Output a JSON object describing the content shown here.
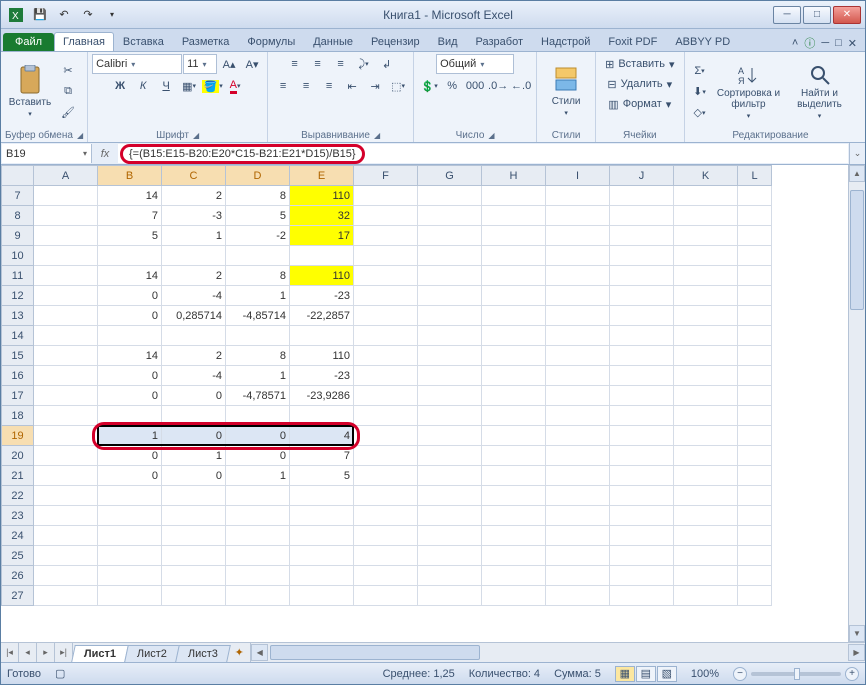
{
  "title": "Книга1 - Microsoft Excel",
  "qat": {
    "save": "💾",
    "undo": "↶",
    "redo": "↷"
  },
  "win": {
    "min": "─",
    "max": "□",
    "close": "✕",
    "help": "?"
  },
  "tabs": {
    "file": "Файл",
    "items": [
      "Главная",
      "Вставка",
      "Разметка",
      "Формулы",
      "Данные",
      "Рецензир",
      "Вид",
      "Разработ",
      "Надстрой",
      "Foxit PDF",
      "ABBYY PD"
    ],
    "activeIndex": 0,
    "helpIcon": "ⓘ"
  },
  "ribbon": {
    "clipboard": {
      "label": "Буфер обмена",
      "paste": "Вставить"
    },
    "font": {
      "label": "Шрифт",
      "family": "Calibri",
      "size": "11",
      "bold": "Ж",
      "italic": "К",
      "underline": "Ч"
    },
    "align": {
      "label": "Выравнивание"
    },
    "number": {
      "label": "Число",
      "format": "Общий"
    },
    "styles": {
      "label": "Стили",
      "btn": "Стили"
    },
    "cells": {
      "label": "Ячейки",
      "insert": "Вставить",
      "delete": "Удалить",
      "format": "Формат"
    },
    "editing": {
      "label": "Редактирование",
      "sort": "Сортировка и фильтр",
      "find": "Найти и выделить"
    }
  },
  "namebox": "B19",
  "fx_label": "fx",
  "formula": "{=(B15:E15-B20:E20*C15-B21:E21*D15)/B15}",
  "columns": [
    "A",
    "B",
    "C",
    "D",
    "E",
    "F",
    "G",
    "H",
    "I",
    "J",
    "K",
    "L"
  ],
  "selectedCols": [
    "B",
    "C",
    "D",
    "E"
  ],
  "rows": [
    {
      "n": 7,
      "c": {
        "B": "14",
        "C": "2",
        "D": "8",
        "E": "110"
      },
      "yellow": [
        "E"
      ]
    },
    {
      "n": 8,
      "c": {
        "B": "7",
        "C": "-3",
        "D": "5",
        "E": "32"
      },
      "yellow": [
        "E"
      ]
    },
    {
      "n": 9,
      "c": {
        "B": "5",
        "C": "1",
        "D": "-2",
        "E": "17"
      },
      "yellow": [
        "E"
      ]
    },
    {
      "n": 10,
      "c": {}
    },
    {
      "n": 11,
      "c": {
        "B": "14",
        "C": "2",
        "D": "8",
        "E": "110"
      },
      "yellow": [
        "E"
      ]
    },
    {
      "n": 12,
      "c": {
        "B": "0",
        "C": "-4",
        "D": "1",
        "E": "-23"
      }
    },
    {
      "n": 13,
      "c": {
        "B": "0",
        "C": "0,285714",
        "D": "-4,85714",
        "E": "-22,2857"
      }
    },
    {
      "n": 14,
      "c": {}
    },
    {
      "n": 15,
      "c": {
        "B": "14",
        "C": "2",
        "D": "8",
        "E": "110"
      }
    },
    {
      "n": 16,
      "c": {
        "B": "0",
        "C": "-4",
        "D": "1",
        "E": "-23"
      }
    },
    {
      "n": 17,
      "c": {
        "B": "0",
        "C": "0",
        "D": "-4,78571",
        "E": "-23,9286"
      }
    },
    {
      "n": 18,
      "c": {}
    },
    {
      "n": 19,
      "c": {
        "B": "1",
        "C": "0",
        "D": "0",
        "E": "4"
      },
      "selRow": true
    },
    {
      "n": 20,
      "c": {
        "B": "0",
        "C": "1",
        "D": "0",
        "E": "7"
      }
    },
    {
      "n": 21,
      "c": {
        "B": "0",
        "C": "0",
        "D": "1",
        "E": "5"
      }
    },
    {
      "n": 22,
      "c": {}
    },
    {
      "n": 23,
      "c": {}
    },
    {
      "n": 24,
      "c": {}
    },
    {
      "n": 25,
      "c": {}
    },
    {
      "n": 26,
      "c": {}
    },
    {
      "n": 27,
      "c": {}
    }
  ],
  "sheets": {
    "items": [
      "Лист1",
      "Лист2",
      "Лист3"
    ],
    "activeIndex": 0
  },
  "status": {
    "ready": "Готово",
    "avg": "Среднее: 1,25",
    "count": "Количество: 4",
    "sum": "Сумма: 5",
    "zoom": "100%",
    "zoomMinus": "−",
    "zoomPlus": "+"
  }
}
